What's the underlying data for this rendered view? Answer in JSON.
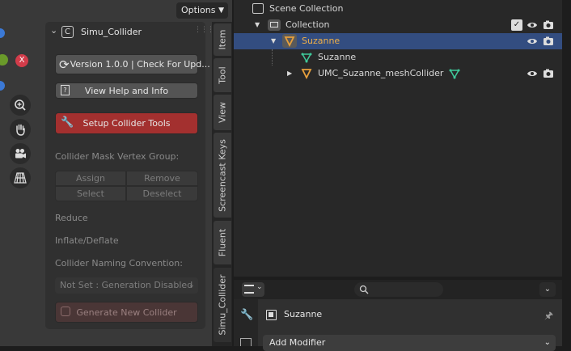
{
  "viewport": {
    "options_label": "Options"
  },
  "panel": {
    "title": "Simu_Collider",
    "version_button": "Version 1.0.0 | Check For Upd...",
    "help_button": "View Help and Info",
    "setup_button": "Setup Collider Tools",
    "mask_label": "Collider Mask Vertex Group:",
    "assign": "Assign",
    "remove": "Remove",
    "select": "Select",
    "deselect": "Deselect",
    "reduce_label": "Reduce",
    "inflate_label": "Inflate/Deflate",
    "naming_label": "Collider Naming Convention:",
    "naming_value": "Not Set : Generation Disabled",
    "generate_button": "Generate New Collider"
  },
  "tabs": [
    "Item",
    "Tool",
    "View",
    "Screencast Keys",
    "Fluent",
    "Simu_Collider"
  ],
  "outliner": {
    "scene_collection": "Scene Collection",
    "collection": "Collection",
    "suzanne": "Suzanne",
    "suzanne_mesh": "Suzanne",
    "collider": "UMC_Suzanne_meshCollider"
  },
  "properties": {
    "object_name": "Suzanne",
    "add_modifier": "Add Modifier"
  },
  "colors": {
    "selected_row": "#334d80",
    "red_button": "#a3302f",
    "object_orange": "#e8a03c",
    "mesh_green": "#3fc99a"
  }
}
